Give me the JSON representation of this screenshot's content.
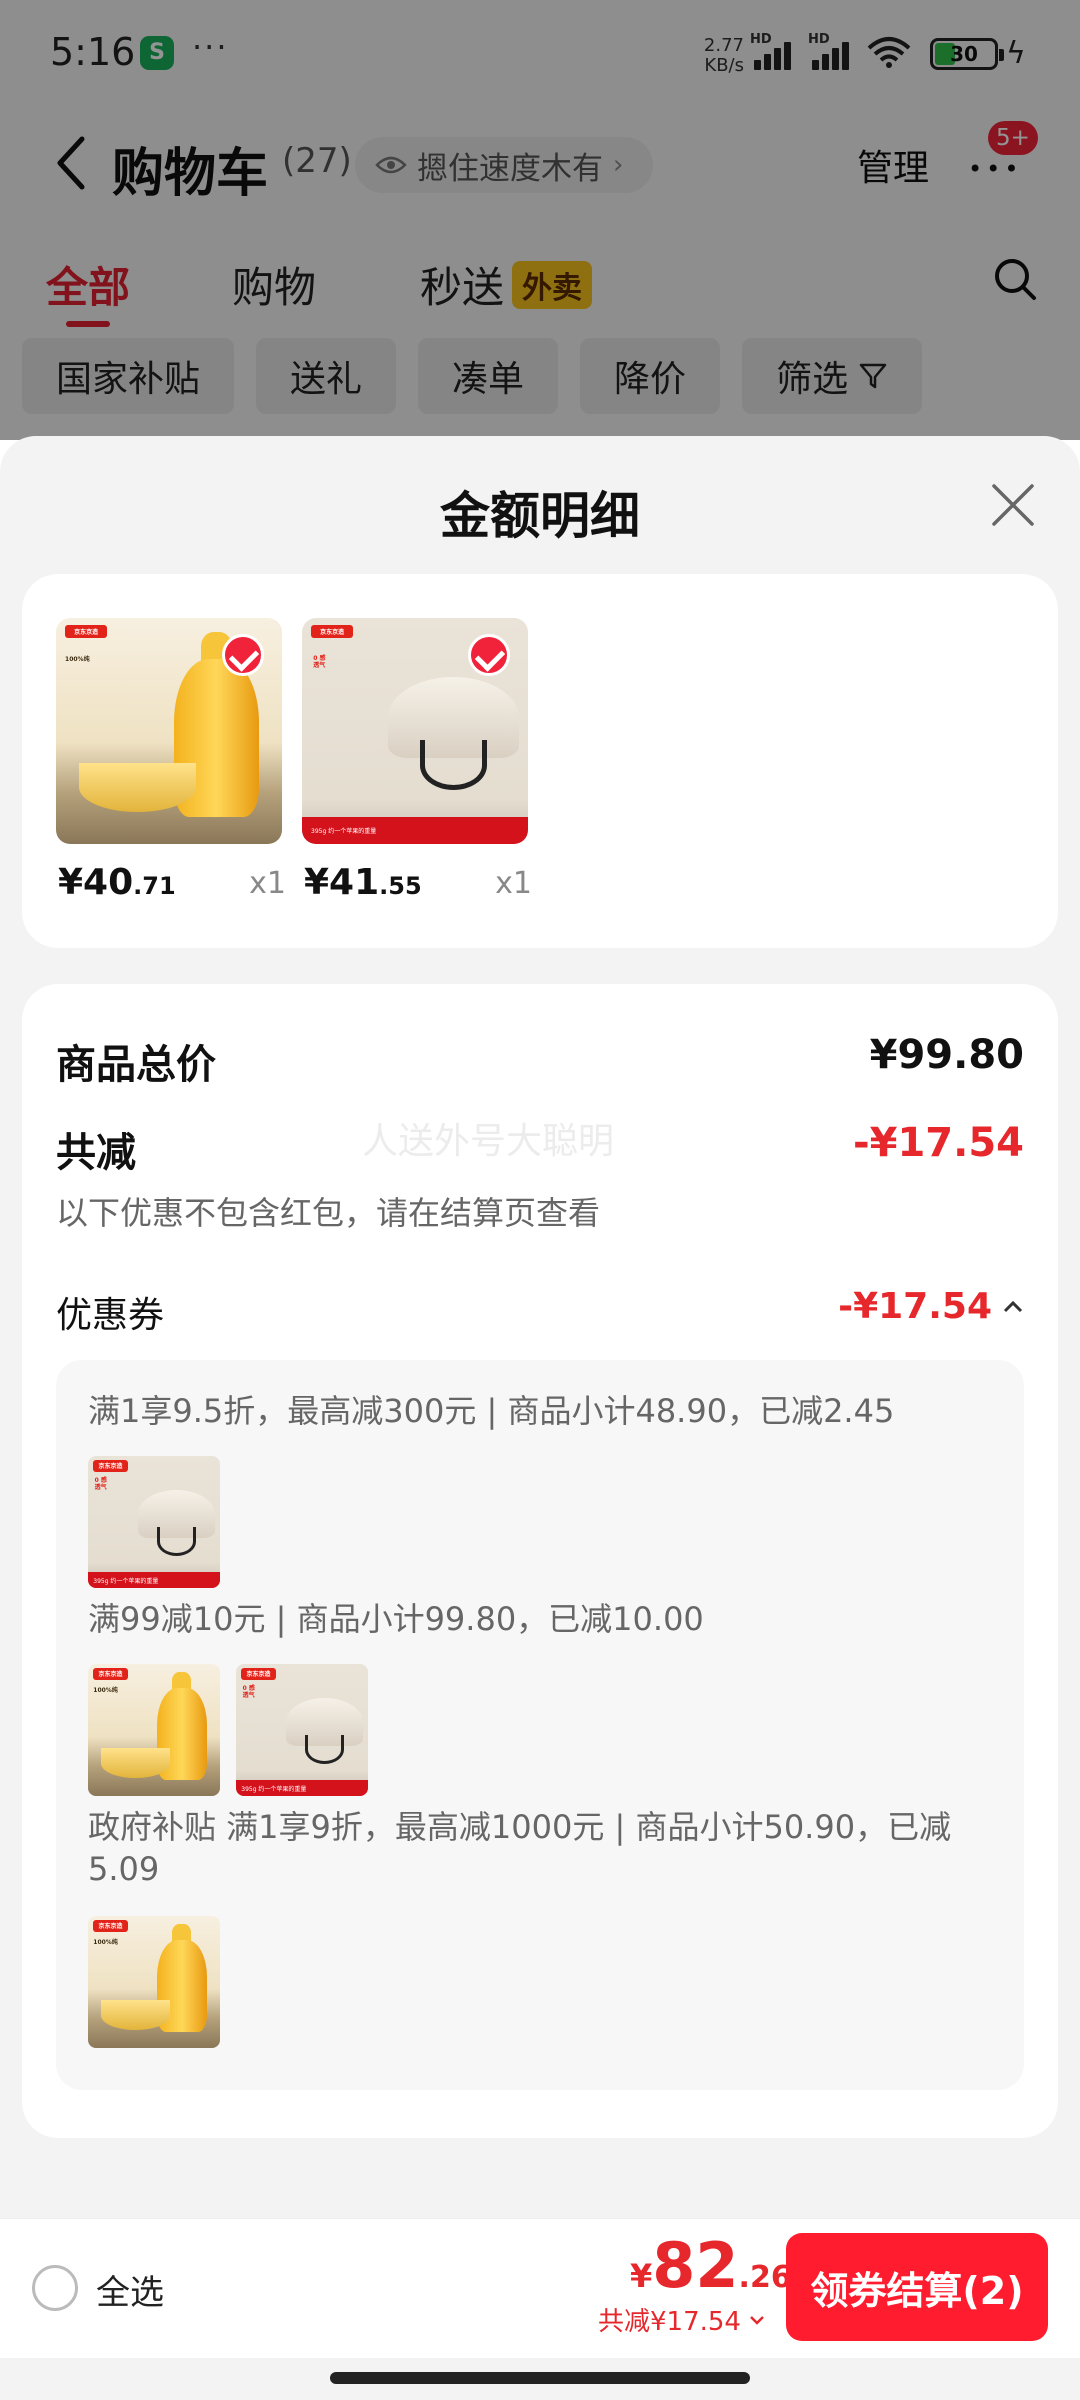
{
  "status_bar": {
    "time": "5:16",
    "speed_top": "2.77",
    "speed_unit": "KB/s",
    "network_1": "HD",
    "network_2": "HD",
    "wifi_label": "6",
    "battery": "30"
  },
  "header": {
    "title": "购物车",
    "count": "(27)",
    "pill_text": "摁住速度木有",
    "manage": "管理",
    "badge": "5+"
  },
  "tabs": [
    {
      "label": "全部"
    },
    {
      "label": "购物"
    },
    {
      "label": "秒送",
      "tag": "外卖"
    }
  ],
  "chips": [
    "国家补贴",
    "送礼",
    "凑单",
    "降价",
    "筛选"
  ],
  "sheet": {
    "title": "金额明细",
    "products": [
      {
        "price_int": "¥40",
        "price_dec": ".71",
        "qty": "x1",
        "icon": "honey-product"
      },
      {
        "price_int": "¥41",
        "price_dec": ".55",
        "qty": "x1",
        "icon": "helmet-product"
      }
    ],
    "product_art": {
      "honey_brand": "京东京造",
      "honey_text": "100%纯",
      "helmet_brand": "京东京造",
      "helmet_text_1": "0 感",
      "helmet_text_2": "透气",
      "helmet_band": "395g  约一个苹果的重量"
    },
    "total_label": "商品总价",
    "total_value": "¥99.80",
    "discount_label": "共减",
    "discount_value": "-¥17.54",
    "watermark": "人送外号大聪明",
    "note": "以下优惠不包含红包，请在结算页查看",
    "coupon_label": "优惠券",
    "coupon_value": "-¥17.54",
    "coupons": [
      {
        "text": "满1享9.5折，最高减300元 | 商品小计48.90，已减2.45"
      },
      {
        "text": "满99减10元 | 商品小计99.80，已减10.00"
      },
      {
        "text": "政府补贴 满1享9折，最高减1000元 | 商品小计50.90，已减5.09"
      }
    ]
  },
  "bottom": {
    "select_all": "全选",
    "currency": "¥",
    "total_int": "82",
    "total_dec": ".26",
    "saved": "共减¥17.54",
    "checkout": "领券结算(2)"
  },
  "colors": {
    "accent": "#e6282c",
    "checkout": "#ff1c2e",
    "tag": "#f6c21c"
  }
}
